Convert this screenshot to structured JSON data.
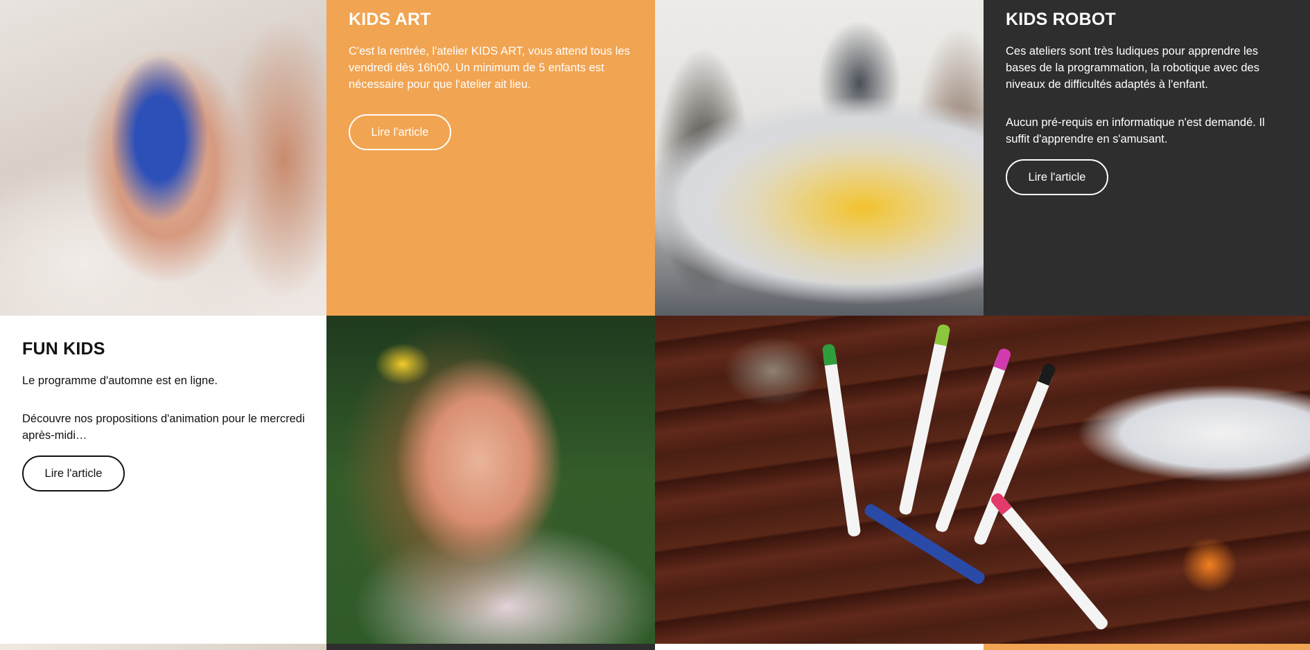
{
  "kids_art": {
    "title": "KIDS ART",
    "paragraphs": [
      "C'est la rentrée, l'atelier KIDS ART, vous attend tous les vendredi dès 16h00. Un minimum de 5 enfants est nécessaire pour que l'atelier ait lieu."
    ],
    "button_label": "Lire l'article"
  },
  "kids_robot": {
    "title": "KIDS ROBOT",
    "paragraphs": [
      "Ces ateliers sont très ludiques pour apprendre les bases de la programmation, la robotique avec des niveaux de difficultés adaptés à l'enfant.",
      "Aucun pré-requis en informatique n'est demandé. Il suffit d'apprendre en s'amusant."
    ],
    "button_label": "Lire l'article"
  },
  "fun_kids": {
    "title": "FUN KIDS",
    "paragraphs": [
      "Le programme d'automne est en ligne.",
      "Découvre nos propositions d'animation pour le mercredi après-midi…"
    ],
    "button_label": "Lire l'article"
  },
  "colors": {
    "orange_tile": "#f1a451",
    "dark_tile": "#2e2e2e",
    "white_tile": "#ffffff"
  }
}
